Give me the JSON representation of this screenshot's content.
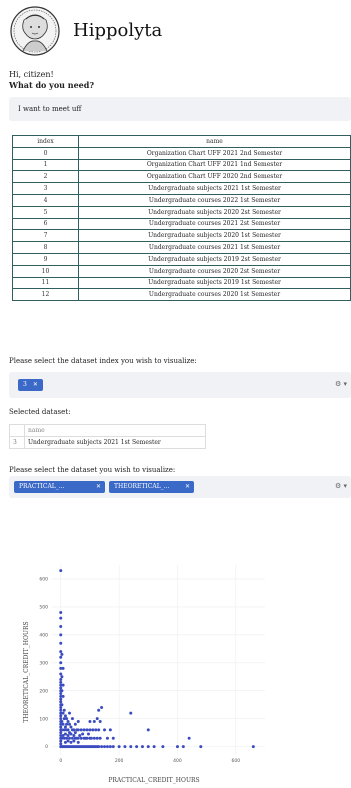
{
  "app": {
    "title": "Hippolyta"
  },
  "greeting": "Hi, citizen!",
  "question": "What do you need?",
  "chat": {
    "message": "I want to meet uff"
  },
  "datasets": {
    "headers": [
      "index",
      "name"
    ],
    "rows": [
      [
        "0",
        "Organization Chart UFF 2021 2nd Semester"
      ],
      [
        "1",
        "Organization Chart UFF 2021 1nd Semester"
      ],
      [
        "2",
        "Organization Chart UFF 2020 2nd Semester"
      ],
      [
        "3",
        "Undergraduate subjects 2021 1st Semester"
      ],
      [
        "4",
        "Undergraduate courses 2022 1st Semester"
      ],
      [
        "5",
        "Undergraduate subjects 2020 2st Semester"
      ],
      [
        "6",
        "Undergraduate courses 2021 2st Semester"
      ],
      [
        "7",
        "Undergraduate subjects 2020 1st Semester"
      ],
      [
        "8",
        "Undergraduate courses 2021 1st Semester"
      ],
      [
        "9",
        "Undergraduate subjects 2019 2st Semester"
      ],
      [
        "10",
        "Undergraduate courses 2020 2st Semester"
      ],
      [
        "11",
        "Undergraduate subjects 2019 1st Semester"
      ],
      [
        "12",
        "Undergraduate courses 2020 1st Semester"
      ]
    ]
  },
  "index_select": {
    "label": "Please select the dataset index you wish to visualize:",
    "chips": [
      "3"
    ]
  },
  "selected_dataset": {
    "label": "Selected dataset:",
    "header": "name",
    "index": "3",
    "name": "Undergraduate subjects 2021 1st Semester"
  },
  "columns_select": {
    "label": "Please select the dataset you wish to visualize:",
    "chips": [
      "PRACTICAL_...",
      "THEORETICAL_..."
    ]
  },
  "chart_data": {
    "type": "scatter",
    "xlabel": "PRACTICAL_CREDIT_HOURS",
    "ylabel": "THEORETICAL_CREDIT_HOURS",
    "xlim": [
      -30,
      700
    ],
    "ylim": [
      -30,
      650
    ],
    "xticks": [
      0,
      200,
      400,
      600
    ],
    "yticks": [
      0,
      100,
      200,
      300,
      400,
      500,
      600
    ],
    "color": "#3b4cc0",
    "points": [
      [
        0,
        630
      ],
      [
        0,
        480
      ],
      [
        0,
        460
      ],
      [
        0,
        430
      ],
      [
        0,
        400
      ],
      [
        0,
        370
      ],
      [
        0,
        340
      ],
      [
        0,
        320
      ],
      [
        0,
        300
      ],
      [
        0,
        280
      ],
      [
        0,
        260
      ],
      [
        0,
        240
      ],
      [
        0,
        230
      ],
      [
        0,
        220
      ],
      [
        0,
        210
      ],
      [
        0,
        200
      ],
      [
        0,
        190
      ],
      [
        0,
        180
      ],
      [
        0,
        170
      ],
      [
        0,
        160
      ],
      [
        0,
        150
      ],
      [
        0,
        140
      ],
      [
        0,
        130
      ],
      [
        0,
        120
      ],
      [
        0,
        110
      ],
      [
        0,
        100
      ],
      [
        0,
        90
      ],
      [
        0,
        80
      ],
      [
        0,
        70
      ],
      [
        0,
        60
      ],
      [
        0,
        50
      ],
      [
        0,
        40
      ],
      [
        0,
        30
      ],
      [
        0,
        20
      ],
      [
        0,
        10
      ],
      [
        0,
        0
      ],
      [
        4,
        330
      ],
      [
        4,
        250
      ],
      [
        4,
        200
      ],
      [
        4,
        150
      ],
      [
        4,
        90
      ],
      [
        4,
        60
      ],
      [
        4,
        30
      ],
      [
        4,
        0
      ],
      [
        8,
        280
      ],
      [
        8,
        220
      ],
      [
        8,
        180
      ],
      [
        8,
        120
      ],
      [
        8,
        80
      ],
      [
        8,
        40
      ],
      [
        8,
        0
      ],
      [
        12,
        130
      ],
      [
        12,
        100
      ],
      [
        12,
        60
      ],
      [
        12,
        30
      ],
      [
        12,
        0
      ],
      [
        16,
        110
      ],
      [
        16,
        70
      ],
      [
        16,
        45
      ],
      [
        16,
        15
      ],
      [
        16,
        0
      ],
      [
        20,
        100
      ],
      [
        20,
        80
      ],
      [
        20,
        60
      ],
      [
        20,
        30
      ],
      [
        20,
        0
      ],
      [
        25,
        90
      ],
      [
        25,
        60
      ],
      [
        25,
        40
      ],
      [
        25,
        20
      ],
      [
        25,
        0
      ],
      [
        30,
        120
      ],
      [
        30,
        80
      ],
      [
        30,
        50
      ],
      [
        30,
        30
      ],
      [
        30,
        0
      ],
      [
        35,
        70
      ],
      [
        35,
        45
      ],
      [
        35,
        15
      ],
      [
        35,
        0
      ],
      [
        40,
        100
      ],
      [
        40,
        60
      ],
      [
        40,
        30
      ],
      [
        40,
        0
      ],
      [
        45,
        60
      ],
      [
        45,
        40
      ],
      [
        45,
        20
      ],
      [
        45,
        0
      ],
      [
        50,
        80
      ],
      [
        50,
        50
      ],
      [
        50,
        30
      ],
      [
        50,
        0
      ],
      [
        55,
        60
      ],
      [
        55,
        30
      ],
      [
        55,
        0
      ],
      [
        60,
        90
      ],
      [
        60,
        60
      ],
      [
        60,
        30
      ],
      [
        60,
        15
      ],
      [
        60,
        0
      ],
      [
        65,
        40
      ],
      [
        65,
        0
      ],
      [
        70,
        60
      ],
      [
        70,
        30
      ],
      [
        70,
        0
      ],
      [
        75,
        45
      ],
      [
        75,
        0
      ],
      [
        80,
        60
      ],
      [
        80,
        30
      ],
      [
        80,
        0
      ],
      [
        85,
        30
      ],
      [
        85,
        0
      ],
      [
        90,
        60
      ],
      [
        90,
        30
      ],
      [
        90,
        0
      ],
      [
        95,
        45
      ],
      [
        95,
        0
      ],
      [
        100,
        90
      ],
      [
        100,
        60
      ],
      [
        100,
        30
      ],
      [
        100,
        0
      ],
      [
        105,
        30
      ],
      [
        105,
        0
      ],
      [
        110,
        60
      ],
      [
        110,
        0
      ],
      [
        115,
        90
      ],
      [
        115,
        30
      ],
      [
        115,
        0
      ],
      [
        120,
        60
      ],
      [
        120,
        0
      ],
      [
        125,
        100
      ],
      [
        125,
        30
      ],
      [
        125,
        0
      ],
      [
        130,
        130
      ],
      [
        130,
        60
      ],
      [
        130,
        0
      ],
      [
        135,
        90
      ],
      [
        135,
        30
      ],
      [
        140,
        140
      ],
      [
        140,
        0
      ],
      [
        150,
        60
      ],
      [
        150,
        0
      ],
      [
        160,
        30
      ],
      [
        160,
        0
      ],
      [
        170,
        60
      ],
      [
        170,
        0
      ],
      [
        180,
        30
      ],
      [
        180,
        0
      ],
      [
        200,
        0
      ],
      [
        220,
        0
      ],
      [
        240,
        120
      ],
      [
        240,
        0
      ],
      [
        260,
        0
      ],
      [
        280,
        0
      ],
      [
        300,
        60
      ],
      [
        300,
        0
      ],
      [
        320,
        0
      ],
      [
        350,
        0
      ],
      [
        400,
        0
      ],
      [
        420,
        0
      ],
      [
        440,
        30
      ],
      [
        480,
        0
      ],
      [
        660,
        0
      ]
    ]
  }
}
